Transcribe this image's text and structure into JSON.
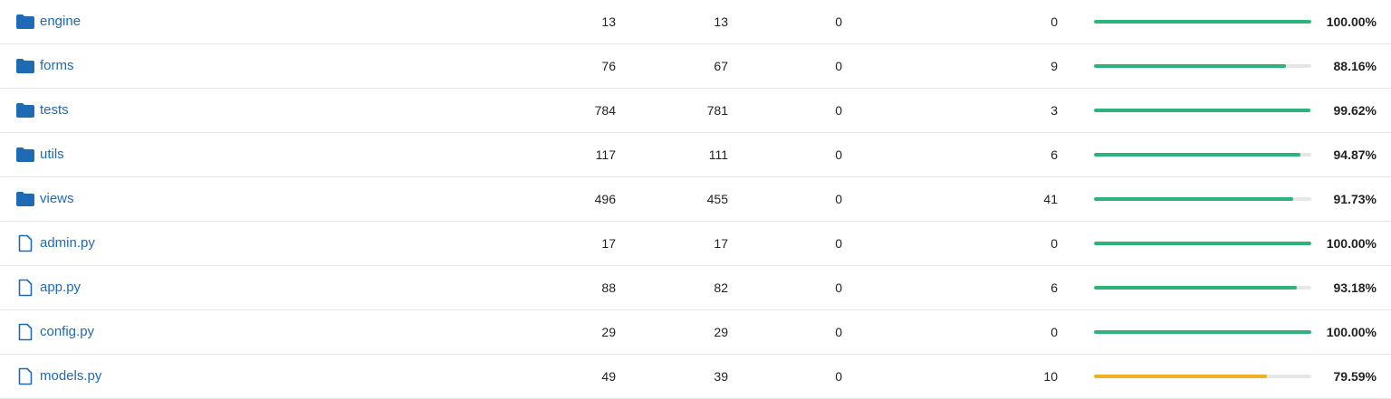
{
  "rows": [
    {
      "name": "engine",
      "icon": "folder-icon",
      "col_a": "13",
      "col_b": "13",
      "col_c": "0",
      "col_d": "0",
      "coverage": 1.0,
      "pct": "100.00%",
      "status": "good"
    },
    {
      "name": "forms",
      "icon": "folder-icon",
      "col_a": "76",
      "col_b": "67",
      "col_c": "0",
      "col_d": "9",
      "coverage": 0.8816,
      "pct": "88.16%",
      "status": "good"
    },
    {
      "name": "tests",
      "icon": "folder-icon",
      "col_a": "784",
      "col_b": "781",
      "col_c": "0",
      "col_d": "3",
      "coverage": 0.9962,
      "pct": "99.62%",
      "status": "good"
    },
    {
      "name": "utils",
      "icon": "folder-icon",
      "col_a": "117",
      "col_b": "111",
      "col_c": "0",
      "col_d": "6",
      "coverage": 0.9487,
      "pct": "94.87%",
      "status": "good"
    },
    {
      "name": "views",
      "icon": "folder-icon",
      "col_a": "496",
      "col_b": "455",
      "col_c": "0",
      "col_d": "41",
      "coverage": 0.9173,
      "pct": "91.73%",
      "status": "good"
    },
    {
      "name": "admin.py",
      "icon": "file-icon",
      "col_a": "17",
      "col_b": "17",
      "col_c": "0",
      "col_d": "0",
      "coverage": 1.0,
      "pct": "100.00%",
      "status": "good"
    },
    {
      "name": "app.py",
      "icon": "file-icon",
      "col_a": "88",
      "col_b": "82",
      "col_c": "0",
      "col_d": "6",
      "coverage": 0.9318,
      "pct": "93.18%",
      "status": "good"
    },
    {
      "name": "config.py",
      "icon": "file-icon",
      "col_a": "29",
      "col_b": "29",
      "col_c": "0",
      "col_d": "0",
      "coverage": 1.0,
      "pct": "100.00%",
      "status": "good"
    },
    {
      "name": "models.py",
      "icon": "file-icon",
      "col_a": "49",
      "col_b": "39",
      "col_c": "0",
      "col_d": "10",
      "coverage": 0.7959,
      "pct": "79.59%",
      "status": "warn"
    }
  ],
  "colors": {
    "link": "#1f6ab5",
    "good": "#2db37b",
    "warn": "#f0b020",
    "track": "#e6e6e6"
  }
}
